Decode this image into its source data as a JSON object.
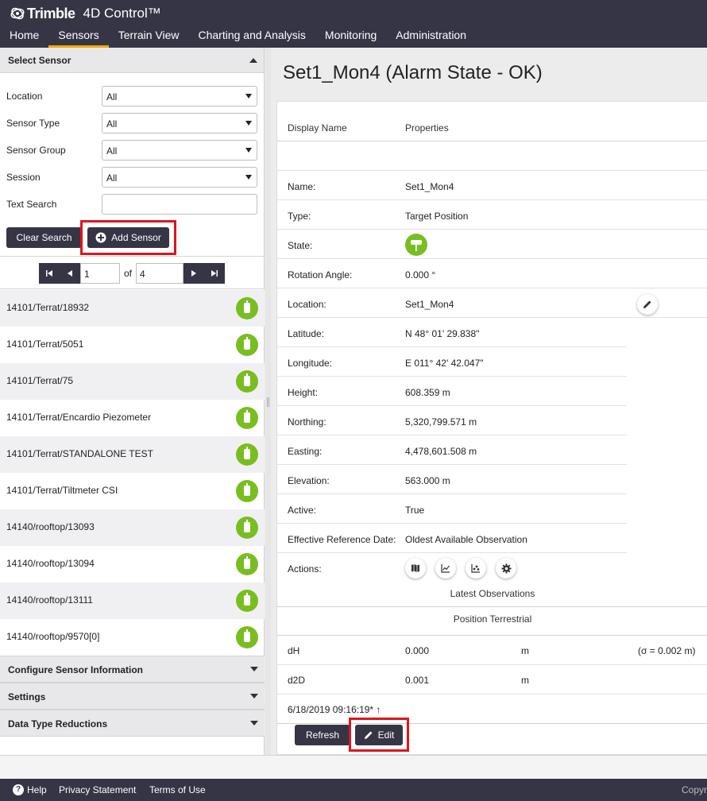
{
  "header": {
    "brand": "Trimble",
    "app_name": "4D Control™",
    "nav": [
      "Home",
      "Sensors",
      "Terrain View",
      "Charting and Analysis",
      "Monitoring",
      "Administration"
    ],
    "active_nav": "Sensors",
    "accent": "#f2a900"
  },
  "left": {
    "select_sensor_title": "Select Sensor",
    "filters": [
      {
        "label": "Location",
        "value": "All"
      },
      {
        "label": "Sensor Type",
        "value": "All"
      },
      {
        "label": "Sensor Group",
        "value": "All"
      },
      {
        "label": "Session",
        "value": "All"
      }
    ],
    "text_search_label": "Text Search",
    "text_search_value": "",
    "clear_search": "Clear Search",
    "add_sensor": "Add Sensor",
    "pager": {
      "page": "1",
      "of_label": "of",
      "total": "4"
    },
    "sensors": [
      "14101/Terrat/18932",
      "14101/Terrat/5051",
      "14101/Terrat/75",
      "14101/Terrat/Encardio Piezometer",
      "14101/Terrat/STANDALONE TEST",
      "14101/Terrat/Tiltmeter CSI",
      "14140/rooftop/13093",
      "14140/rooftop/13094",
      "14140/rooftop/13111",
      "14140/rooftop/9570[0]"
    ],
    "bottom_sections": [
      "Configure Sensor Information",
      "Settings",
      "Data Type Reductions"
    ],
    "status_color": "#78be20"
  },
  "right": {
    "title": "Set1_Mon4 (Alarm State - OK)",
    "col_display_name": "Display Name",
    "col_properties": "Properties",
    "properties": [
      {
        "label": "Name:",
        "value": "Set1_Mon4"
      },
      {
        "label": "Type:",
        "value": "Target Position"
      },
      {
        "label": "State:",
        "value": ""
      },
      {
        "label": "Rotation Angle:",
        "value": "0.000 °"
      },
      {
        "label": "Location:",
        "value": "Set1_Mon4"
      },
      {
        "label": "Latitude:",
        "value": "N 48° 01' 29.838\""
      },
      {
        "label": "Longitude:",
        "value": "E 011° 42' 42.047\""
      },
      {
        "label": "Height:",
        "value": "608.359 m"
      },
      {
        "label": "Northing:",
        "value": "5,320,799.571 m"
      },
      {
        "label": "Easting:",
        "value": "4,478,601.508 m"
      },
      {
        "label": "Elevation:",
        "value": "563.000 m"
      },
      {
        "label": "Active:",
        "value": "True"
      },
      {
        "label": "Effective Reference Date:",
        "value": "Oldest Available Observation"
      },
      {
        "label": "Actions:",
        "value": ""
      }
    ],
    "latest_observations": "Latest Observations",
    "position_terrestrial": "Position Terrestrial",
    "observations": [
      {
        "name": "dH",
        "value": "0.000",
        "unit": "m",
        "sigma": "(σ = 0.002 m)"
      },
      {
        "name": "d2D",
        "value": "0.001",
        "unit": "m",
        "sigma": ""
      }
    ],
    "timestamp": "6/18/2019 09:16:19* ↑",
    "refresh": "Refresh",
    "edit": "Edit"
  },
  "footer": {
    "help": "Help",
    "privacy": "Privacy Statement",
    "terms": "Terms of Use",
    "copyright": "Copyr"
  }
}
